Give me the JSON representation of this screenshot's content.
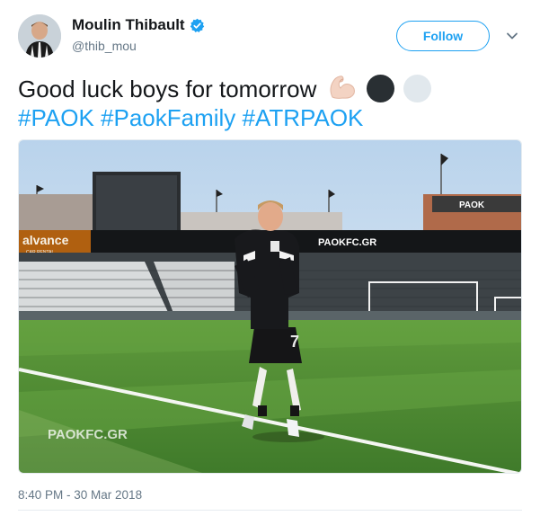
{
  "author": {
    "name": "Moulin Thibault",
    "handle": "@thib_mou",
    "verified": true,
    "avatar_icon": "avatar-player-photo"
  },
  "follow_label": "Follow",
  "caret_icon": "chevron-down-icon",
  "tweet": {
    "text": "Good luck boys for tomorrow",
    "emojis": [
      "flexed-biceps",
      "black-circle",
      "white-circle"
    ],
    "hashtags": [
      "#PAOK",
      "#PaokFamily",
      "#ATRPAOK"
    ]
  },
  "photo": {
    "description_icon": "photo-player-running",
    "signage": {
      "left_board": "alvance",
      "left_board_sub": "CAR RENTAL",
      "center_board": "PAOKFC.GR",
      "right_board": "PAOK"
    },
    "watermark": "PAOKFC.GR",
    "shirt_number": "7"
  },
  "timestamp": "8:40 PM - 30 Mar 2018",
  "colors": {
    "accent": "#1da1f2",
    "text": "#14171a",
    "muted": "#657786",
    "pitch": "#4f8a33"
  }
}
